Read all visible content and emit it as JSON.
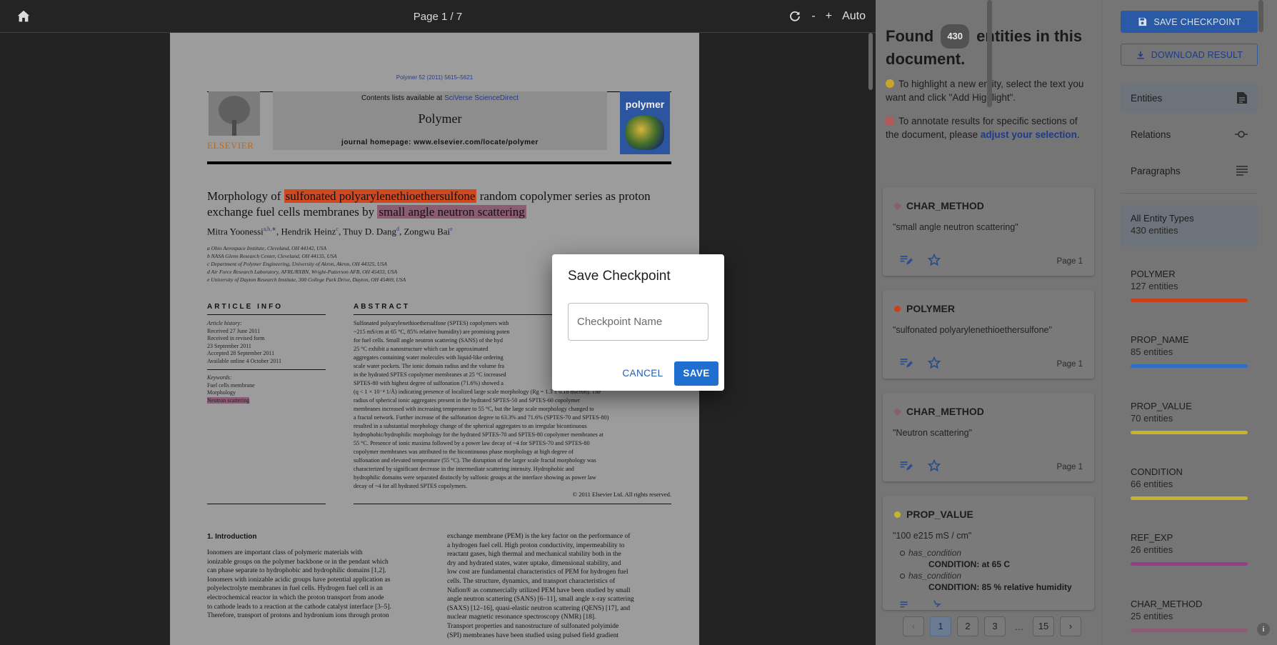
{
  "viewer": {
    "page_indicator": "Page 1 / 7",
    "zoom_out": "-",
    "zoom_in": "+",
    "zoom_label": "Auto"
  },
  "paper": {
    "journal_ref": "Polymer 52 (2011) 5615–5621",
    "contents_prefix": "Contents lists available at ",
    "contents_link": "SciVerse ScienceDirect",
    "journal_name": "Polymer",
    "homepage": "journal homepage: www.elsevier.com/locate/polymer",
    "publisher": "ELSEVIER",
    "cover_title": "polymer",
    "title_pre": "Morphology of ",
    "title_hl1": "sulfonated polyarylenethioethersulfone",
    "title_mid": " random copolymer series as proton exchange fuel cells membranes by ",
    "title_hl2": "small angle neutron scattering",
    "authors": [
      {
        "name": "Mitra Yoonessi",
        "sup": "a,b,∗"
      },
      {
        "name": "Hendrik Heinz",
        "sup": "c"
      },
      {
        "name": "Thuy D. Dang",
        "sup": "d"
      },
      {
        "name": "Zongwu Bai",
        "sup": "e"
      }
    ],
    "affiliations": [
      "a Ohio Aerospace Institute, Cleveland, OH 44142, USA",
      "b NASA Glenn Research Center, Cleveland, OH 44135, USA",
      "c Department of Polymer Engineering, University of Akron, Akron, OH 44325, USA",
      "d Air Force Research Laboratory, AFRL/RXBN, Wright-Patterson AFB, OH 45433, USA",
      "e University of Dayton Research Institute, 300 College Park Drive, Dayton, OH 45469, USA"
    ],
    "article_info_heading": "ARTICLE INFO",
    "abstract_heading": "ABSTRACT",
    "article_history_label": "Article history:",
    "history": [
      "Received 27 June 2011",
      "Received in revised form",
      "23 September 2011",
      "Accepted 28 September 2011",
      "Available online 4 October 2011"
    ],
    "keywords_label": "Keywords:",
    "keywords": [
      "Fuel cells membrane",
      "Morphology",
      "Neutron scattering"
    ],
    "abstract_lines": [
      "Sulfonated polyarylenethioethersulfone (SPTES) copolymers with",
      "~215 mS/cm at 65 °C, 85% relative humidity) are promising poten",
      "for fuel cells. Small angle neutron scattering (SANS) of the hyd",
      "25 °C exhibit a nanostructure which can be approximated",
      "aggregates containing water molecules with liquid-like ordering",
      "scale water pockets. The ionic domain radius and the volume fra",
      "in the hydrated SPTES copolymer membranes at 25 °C increased",
      "SPTES-80 with highest degree of sulfonation (71.6%) showed a",
      "(q < 1 × 10⁻⁴ 1/Å) indicating presence of localized large scale morphology (Rg = 1.3 ± 0.18 micron). The",
      "radius of spherical ionic aggregates present in the hydrated SPTES-50 and SPTES-60 copolymer",
      "membranes increased with increasing temperature to 55 °C, but the large scale morphology changed to",
      "a fractal network. Further increase of the sulfonation degree to 63.3% and 71.6% (SPTES-70 and SPTES-80)",
      "resulted in a substantial morphology change of the spherical aggregates to an irregular bicontinuous",
      "hydrophobic/hydrophilic morphology for the hydrated SPTES-70 and SPTES-80 copolymer membranes at",
      "55 °C. Presence of ionic maxima followed by a power law decay of ~4 for SPTES-70 and SPTES-80",
      "copolymer membranes was attributed to the bicontinuous phase morphology at high degree of",
      "sulfonation and elevated temperature (55 °C). The disruption of the larger scale fractal morphology was",
      "characterized by significant decrease in the intermediate scattering intensity. Hydrophobic and",
      "hydrophilic domains were separated distinctly by sulfonic groups at the interface showing as power law",
      "decay of ~4 for all hydrated SPTES copolymers."
    ],
    "copyright": "© 2011 Elsevier Ltd. All rights reserved.",
    "intro_heading": "1.  Introduction",
    "intro_left": [
      "Ionomers are important class of polymeric materials with",
      "ionizable groups on the polymer backbone or in the pendant which",
      "can phase separate to hydrophobic and hydrophilic domains [1,2].",
      "Ionomers with ionizable acidic groups have potential application as",
      "polyelectrolyte membranes in fuel cells. Hydrogen fuel cell is an",
      "electrochemical reactor in which the proton transport from anode",
      "to cathode leads to a reaction at the cathode catalyst interface [3–5].",
      "Therefore, transport of protons and hydronium ions through proton"
    ],
    "intro_right": [
      "exchange membrane (PEM) is the key factor on the performance of",
      "a hydrogen fuel cell. High proton conductivity, impermeability to",
      "reactant gases, high thermal and mechanical stability both in the",
      "dry and hydrated states, water uptake, dimensional stability, and",
      "low cost are fundamental characteristics of PEM for hydrogen fuel",
      "cells. The structure, dynamics, and transport characteristics of",
      "Nafion® as commercially utilized PEM have been studied by small",
      "angle neutron scattering (SANS) [6–11], small angle x-ray scattering",
      "(SAXS) [12–16], quasi-elastic neutron scattering (QENS) [17], and",
      "nuclear magnetic resonance spectroscopy (NMR) [18].",
      "   Transport properties and nanostructure of sulfonated polyimide",
      "(SPI) membranes have been studied using pulsed field gradient"
    ]
  },
  "results": {
    "found_pre": "Found",
    "found_count": "430",
    "found_post": "entities in this document.",
    "hint1": "To highlight a new entity, select the text you want and click \"Add Highlight\".",
    "hint2_pre": "To annotate results for specific sections of the document, please ",
    "hint2_link": "adjust your selection",
    "hint2_post": ".",
    "cards": [
      {
        "type": "CHAR_METHOD",
        "text": "\"small angle neutron scattering\"",
        "page": "Page 1",
        "color": "#8c5c74"
      },
      {
        "type": "POLYMER",
        "text": "\"sulfonated polyarylenethioethersulfone\"",
        "page": "Page 1",
        "color": "#c8401c"
      },
      {
        "type": "CHAR_METHOD",
        "text": "\"Neutron scattering\"",
        "page": "Page 1",
        "color": "#8c5c74"
      },
      {
        "type": "PROP_VALUE",
        "text": "\"100 e215 mS / cm\"",
        "color": "#c8b42a",
        "relations": [
          {
            "rel": "has_condition",
            "val": "CONDITION: at 65 C"
          },
          {
            "rel": "has_condition",
            "val": "CONDITION: 85 % relative humidity"
          }
        ]
      }
    ],
    "pagination": [
      "1",
      "2",
      "3",
      "…",
      "15"
    ]
  },
  "sidebar": {
    "save_checkpoint": "SAVE CHECKPOINT",
    "download_result": "DOWNLOAD RESULT",
    "nav": [
      {
        "label": "Entities",
        "icon": "document-icon"
      },
      {
        "label": "Relations",
        "icon": "commit-icon"
      },
      {
        "label": "Paragraphs",
        "icon": "paragraph-icon"
      }
    ],
    "entity_types": [
      {
        "name": "All Entity Types",
        "count": "430 entities"
      },
      {
        "name": "POLYMER",
        "count": "127 entities",
        "color": "#c8401c"
      },
      {
        "name": "PROP_NAME",
        "count": "85 entities",
        "color": "#2f6ec4"
      },
      {
        "name": "PROP_VALUE",
        "count": "70 entities",
        "color": "#c8b42a"
      },
      {
        "name": "CONDITION",
        "count": "66 entities",
        "color": "#c8b42a"
      },
      {
        "name": "REF_EXP",
        "count": "26 entities",
        "color": "#9c3a8a"
      },
      {
        "name": "CHAR_METHOD",
        "count": "25 entities",
        "color": "#8c5c74"
      }
    ]
  },
  "dialog": {
    "title": "Save Checkpoint",
    "placeholder": "Checkpoint Name",
    "cancel": "CANCEL",
    "save": "SAVE"
  }
}
